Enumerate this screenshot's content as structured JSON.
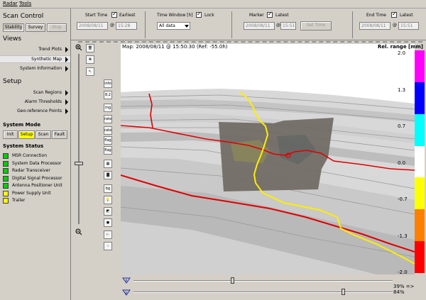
{
  "menu": {
    "radar": "Radar",
    "tools": "Tools"
  },
  "scan_control": {
    "heading": "Scan Control",
    "buttons": [
      {
        "label": "Stability",
        "pressed": true
      },
      {
        "label": "Survey"
      },
      {
        "label": "Stop",
        "disabled": true
      }
    ]
  },
  "views": {
    "heading": "Views",
    "items": [
      {
        "label": "Trend Plots"
      },
      {
        "label": "Synthetic Map",
        "selected": true
      },
      {
        "label": "System Information"
      }
    ]
  },
  "setup": {
    "heading": "Setup",
    "items": [
      {
        "label": "Scan Regions"
      },
      {
        "label": "Alarm Thresholds"
      },
      {
        "label": "Geo-reference Points"
      }
    ]
  },
  "system_mode": {
    "heading": "System Mode",
    "buttons": [
      {
        "label": "Init"
      },
      {
        "label": "Setup",
        "active": true
      },
      {
        "label": "Scan"
      },
      {
        "label": "Fault"
      }
    ]
  },
  "system_status": {
    "heading": "System Status",
    "items": [
      {
        "label": "MSR Connection",
        "color": "#00cc00"
      },
      {
        "label": "System Data Processor",
        "color": "#00cc00"
      },
      {
        "label": "Radar Transceiver",
        "color": "#00cc00"
      },
      {
        "label": "Digital Signal Processor",
        "color": "#00cc00"
      },
      {
        "label": "Antenna Positioner Unit",
        "color": "#00cc00"
      },
      {
        "label": "Power Supply Unit",
        "color": "#ffff00"
      },
      {
        "label": "Trailer",
        "color": "#ffff00"
      }
    ]
  },
  "time_controls": {
    "start_time_label": "Start Time",
    "earliest_label": "Earliest",
    "start_date": "2008/08/11",
    "start_at": "@",
    "start_time": "15:28",
    "window_label": "Time Window [h]",
    "lock_label": "Lock",
    "window_value": "All data",
    "marker_label": "Marker",
    "latest_label": "Latest",
    "marker_date": "2008/08/11",
    "marker_at": "@",
    "marker_time": "15:51",
    "set_time": "Set Time",
    "end_time_label": "End Time",
    "end_latest_label": "Latest",
    "end_date": "2008/08/11",
    "end_at": "@",
    "end_time": "15:51"
  },
  "tools": [
    {
      "name": "trash-icon",
      "label": "🗑"
    },
    {
      "name": "move-icon",
      "label": "✥"
    },
    {
      "name": "cursor-icon",
      "label": "↖"
    },
    {
      "name": "info-icon",
      "label": "info"
    },
    {
      "name": "scale-icon",
      "label": "8.2"
    },
    {
      "name": "rel-rng-icon",
      "label": "rng"
    },
    {
      "name": "rate-icon",
      "label": "rate"
    },
    {
      "name": "rate-vis-icon",
      "label": "rate"
    },
    {
      "name": "flag-icon",
      "label": "flag"
    },
    {
      "name": "flag2-icon",
      "label": "flag"
    },
    {
      "name": "grid-icon",
      "label": "▦"
    },
    {
      "name": "texture-icon",
      "label": "▓"
    },
    {
      "name": "bg-icon",
      "label": "bg"
    },
    {
      "name": "light-icon",
      "label": "💡"
    },
    {
      "name": "shade-icon",
      "label": "◩"
    },
    {
      "name": "cube-icon",
      "label": "◼"
    },
    {
      "name": "axis-icon",
      "label": "⊢"
    },
    {
      "name": "points-icon",
      "label": "⁘"
    }
  ],
  "map": {
    "title": "Map: 2008/08/11 @ 15:50:30 (Ref: -55.0h)",
    "range_title": "Rel. range [mm]",
    "legend_labels": [
      "2.0",
      "1.3",
      "0.7",
      "0.0",
      "-0.7",
      "-1.3",
      "-2.0"
    ],
    "legend_colors": [
      "#ff00ff",
      "#0000ff",
      "#00ffff",
      "#ffffff",
      "#ffff00",
      "#ff8000",
      "#ff0000"
    ]
  },
  "bottom": {
    "zoom_text": "39% => 84%"
  }
}
